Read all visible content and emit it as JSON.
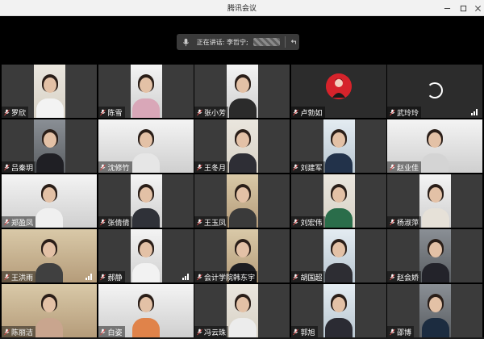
{
  "window": {
    "title": "腾讯会议",
    "controls": [
      "minimize-icon",
      "maximize-icon",
      "close-icon"
    ]
  },
  "speaker": {
    "label": "正在讲话: 李哲宁;"
  },
  "participants": [
    {
      "name": "罗欣",
      "scene": "wall",
      "shirt": "#f3f3f3",
      "signal": false
    },
    {
      "name": "陈雪",
      "scene": "office",
      "shirt": "#d9a7b8",
      "signal": false
    },
    {
      "name": "张小芳",
      "scene": "office",
      "shirt": "#2b2b2b",
      "signal": false
    },
    {
      "name": "卢勃如",
      "scene": "avatar",
      "shirt": "",
      "signal": false
    },
    {
      "name": "武玲玲",
      "scene": "loading",
      "shirt": "",
      "signal": true
    },
    {
      "name": "吕秦玥",
      "scene": "room",
      "shirt": "#1f1f24",
      "signal": false
    },
    {
      "name": "沈修竹",
      "scene": "office-wide",
      "shirt": "#e6e6e6",
      "signal": false
    },
    {
      "name": "王冬月",
      "scene": "wall",
      "shirt": "#2e2e35",
      "signal": false
    },
    {
      "name": "刘建军",
      "scene": "cool",
      "shirt": "#22324a",
      "signal": false
    },
    {
      "name": "赵业佳",
      "scene": "office-wide",
      "shirt": "#d4d4d4",
      "signal": false
    },
    {
      "name": "郑盈凤",
      "scene": "office-wide",
      "shirt": "#f0f0f0",
      "signal": false
    },
    {
      "name": "张倩倩",
      "scene": "office",
      "shirt": "#2f3138",
      "signal": false
    },
    {
      "name": "王玉凤",
      "scene": "warm",
      "shirt": "#3a3a3a",
      "signal": false
    },
    {
      "name": "刘宏伟",
      "scene": "wall",
      "shirt": "#2a6d4a",
      "signal": false
    },
    {
      "name": "杨淑萍",
      "scene": "office",
      "shirt": "#e6e1d8",
      "signal": false
    },
    {
      "name": "王洪雨",
      "scene": "warm-wide",
      "shirt": "#404040",
      "signal": true
    },
    {
      "name": "郝静",
      "scene": "office",
      "shirt": "#f2f2f2",
      "signal": true
    },
    {
      "name": "会计学院韩东宇",
      "scene": "warm",
      "shirt": "#1e1e22",
      "signal": false
    },
    {
      "name": "胡国超",
      "scene": "cool",
      "shirt": "#2d2d33",
      "signal": false
    },
    {
      "name": "赵会娇",
      "scene": "room",
      "shirt": "#23232a",
      "signal": false
    },
    {
      "name": "陈丽洁",
      "scene": "warm-wide",
      "shirt": "#c9a58e",
      "signal": false
    },
    {
      "name": "白姿",
      "scene": "office-wide",
      "shirt": "#e0834a",
      "signal": false
    },
    {
      "name": "冯云珠",
      "scene": "wall",
      "shirt": "#ececec",
      "signal": false
    },
    {
      "name": "郭旭",
      "scene": "cool",
      "shirt": "#2b2b33",
      "signal": false
    },
    {
      "name": "邵博",
      "scene": "room",
      "shirt": "#1c2c40",
      "signal": false
    }
  ],
  "colors": {
    "background": "#000000",
    "tile": "#3b3b3b",
    "mic_muted": "#e04848",
    "avatar_bg": "#d6232b"
  }
}
